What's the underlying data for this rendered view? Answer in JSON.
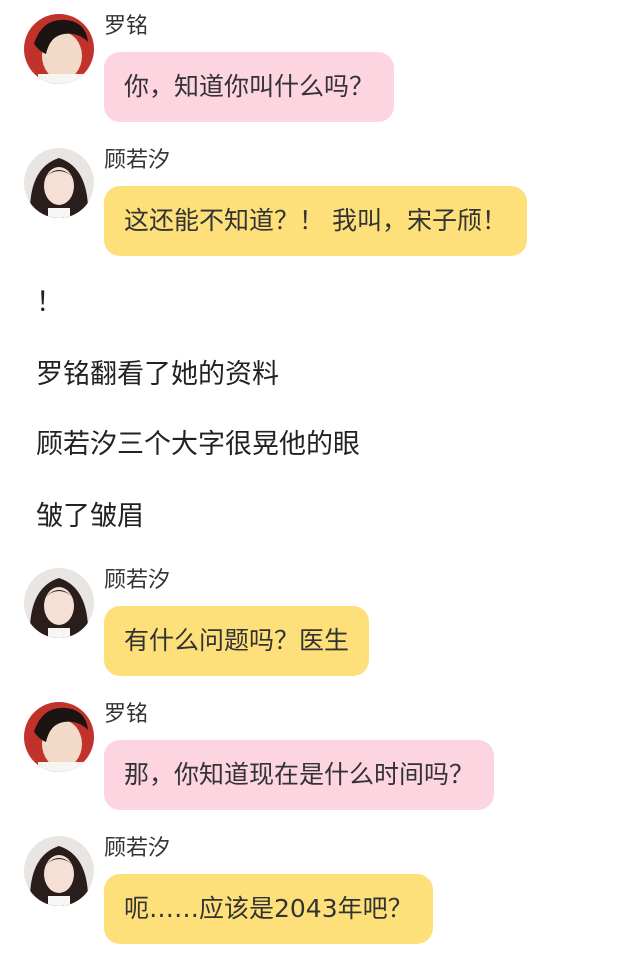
{
  "messages": [
    {
      "speaker": "罗铭",
      "text": "你，知道你叫什么吗？",
      "bubble_color": "#fdd5e0",
      "avatar": "male-avatar"
    },
    {
      "speaker": "顾若汐",
      "text": "这还能不知道？！ 我叫，宋子颀！",
      "bubble_color": "#fee07a",
      "avatar": "female-avatar"
    },
    {
      "speaker": "顾若汐",
      "text": "有什么问题吗？医生",
      "bubble_color": "#fee07a",
      "avatar": "female-avatar"
    },
    {
      "speaker": "罗铭",
      "text": "那，你知道现在是什么时间吗？",
      "bubble_color": "#fdd5e0",
      "avatar": "male-avatar"
    },
    {
      "speaker": "顾若汐",
      "text": "呃……应该是2043年吧？",
      "bubble_color": "#fee07a",
      "avatar": "female-avatar"
    }
  ],
  "narration": [
    "！",
    "罗铭翻看了她的资料",
    "顾若汐三个大字很晃他的眼",
    "皱了皱眉"
  ]
}
